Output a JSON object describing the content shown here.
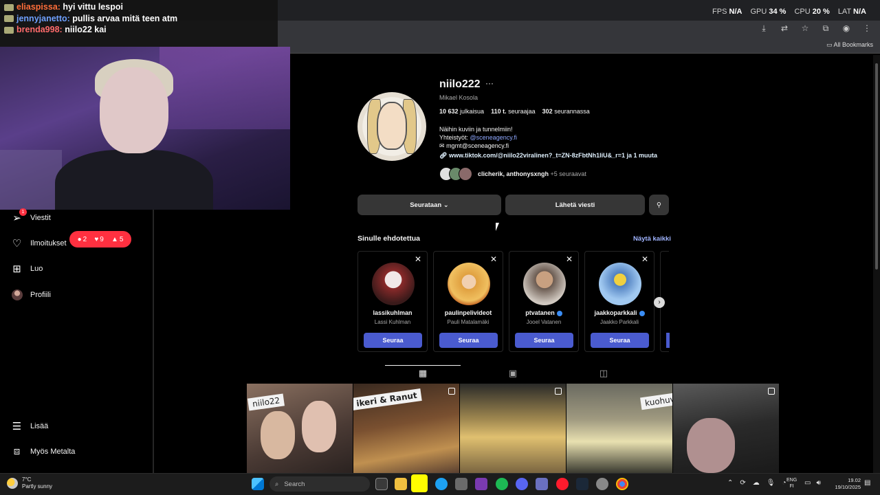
{
  "perf": {
    "fps_label": "FPS",
    "fps_value": "N/A",
    "gpu_label": "GPU",
    "gpu_value": "34 %",
    "cpu_label": "CPU",
    "cpu_value": "20 %",
    "lat_label": "LAT",
    "lat_value": "N/A"
  },
  "browser": {
    "bookmarks_label": "All Bookmarks"
  },
  "stream_chat": [
    {
      "user": "eliaspissa:",
      "message": "hyi vittu lespoi"
    },
    {
      "user": "jennyjanetto:",
      "message": "pullis arvaa mitä teen atm"
    },
    {
      "user": "brenda998:",
      "message": "niilo22 kai"
    }
  ],
  "sidebar": {
    "items": [
      {
        "label": "Viestit",
        "icon": "messages-icon"
      },
      {
        "label": "Ilmoitukset",
        "icon": "heart-icon"
      },
      {
        "label": "Luo",
        "icon": "create-icon"
      },
      {
        "label": "Profiili",
        "icon": "profile-avatar"
      },
      {
        "label": "Lisää",
        "icon": "menu-icon"
      },
      {
        "label": "Myös Metalta",
        "icon": "meta-icon"
      }
    ],
    "messages_badge": "1",
    "notifications": {
      "comments": "2",
      "likes": "9",
      "follows": "5"
    }
  },
  "profile": {
    "username": "niilo222",
    "more": "···",
    "full_name": "Mikael Kosola",
    "posts_count": "10 632",
    "posts_label": "julkaisua",
    "followers_count": "110 t.",
    "followers_label": "seuraajaa",
    "following_count": "302",
    "following_label": "seurannassa",
    "bio_line1": "Näihin kuviin ja tunnelmiin!",
    "bio_line2_prefix": "Yhteistyöt: ",
    "bio_line2_link": "@sceneagency.fi",
    "bio_line3": "mgmt@sceneagency.fi",
    "link": "www.tiktok.com/@niilo22viralinen?_t=ZN-8zFbtNh1IiU&_r=1 ja 1 muuta",
    "followed_by_names": "clicherik, anthonysxngh",
    "followed_by_more": "+5 seuraavat",
    "following_button": "Seurataan",
    "message_button": "Lähetä viesti"
  },
  "suggestions": {
    "title": "Sinulle ehdotettua",
    "see_all": "Näytä kaikki",
    "follow_label": "Seuraa",
    "cards": [
      {
        "username": "lassikuhlman",
        "name": "Lassi Kuhlman",
        "verified": false,
        "color": "#8a2a2a"
      },
      {
        "username": "paulinpelivideot",
        "name": "Pauli Matalamäki",
        "verified": false,
        "color": "#e0a040"
      },
      {
        "username": "ptvatanen",
        "name": "Jooel Vatanen",
        "verified": true,
        "color": "#a08070"
      },
      {
        "username": "jaakkoparkkali",
        "name": "Jaakko Parkkali",
        "verified": true,
        "color": "#80b0e0"
      }
    ]
  },
  "posts": [
    {
      "tag": "niilo22",
      "color": "#6a5a50"
    },
    {
      "tag": "ikeri & Ranut",
      "color": "#5a4030"
    },
    {
      "tag": "",
      "color": "#7a6540"
    },
    {
      "tag": "kuohuvii",
      "color": "#5a5a50"
    },
    {
      "tag": "",
      "color": "#3a3a3a"
    }
  ],
  "taskbar": {
    "temperature": "7°C",
    "weather": "Partly sunny",
    "search_placeholder": "Search",
    "lang_line1": "ENG",
    "lang_line2": "FI",
    "time": "19.02",
    "date": "19/10/2025"
  }
}
